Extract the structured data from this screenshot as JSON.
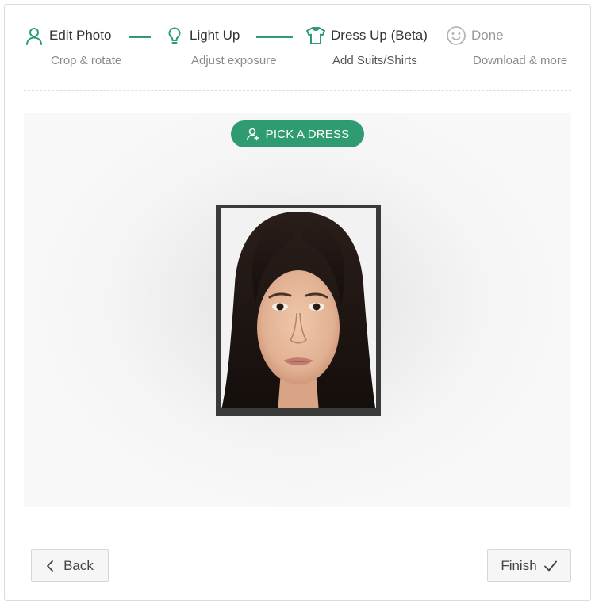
{
  "stepper": {
    "steps": [
      {
        "title": "Edit Photo",
        "desc": "Crop & rotate",
        "icon": "user-icon",
        "state": "completed"
      },
      {
        "title": "Light Up",
        "desc": "Adjust exposure",
        "icon": "lightbulb-icon",
        "state": "completed"
      },
      {
        "title": "Dress Up (Beta)",
        "desc": "Add Suits/Shirts",
        "icon": "shirt-icon",
        "state": "current"
      },
      {
        "title": "Done",
        "desc": "Download & more",
        "icon": "smiley-icon",
        "state": "pending"
      }
    ]
  },
  "stage": {
    "pick_label": "PICK A DRESS"
  },
  "footer": {
    "back_label": "Back",
    "finish_label": "Finish"
  },
  "colors": {
    "accent": "#2e9b70",
    "pending": "#b5b5b5",
    "text": "#333333",
    "subtext": "#8a8a8a"
  }
}
